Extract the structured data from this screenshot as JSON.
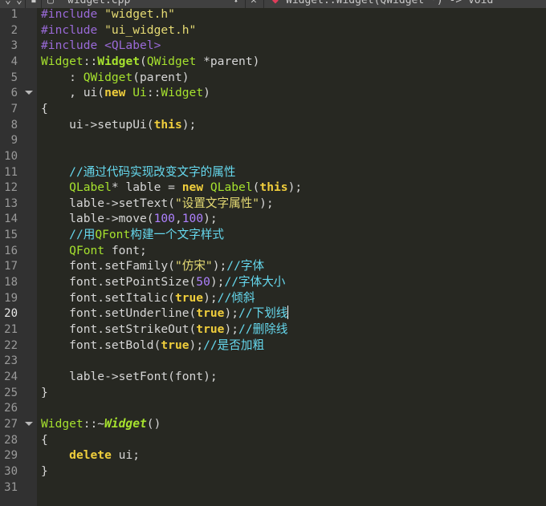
{
  "tabbar": {
    "file_name": "widget.cpp",
    "close_glyph": "✕",
    "symbol_glyph": "◆",
    "function_symbol": "Widget::Widget(QWidget *) -> void"
  },
  "colors": {
    "background": "#272822",
    "gutter": "#313131",
    "line_number": "#9a9a9a",
    "preprocessor": "#9a6ad8",
    "string": "#e6db74",
    "type": "#a6e22e",
    "keyword": "#f0ce3c",
    "number": "#ae81ff",
    "comment_text": "#66d9ef",
    "plain": "#d6d6d6"
  },
  "editor": {
    "current_line": 20,
    "fold_markers": [
      6,
      27
    ],
    "lines": [
      [
        [
          "#include ",
          "pp"
        ],
        [
          "\"widget.h\"",
          "str"
        ]
      ],
      [
        [
          "#include ",
          "pp"
        ],
        [
          "\"ui_widget.h\"",
          "str"
        ]
      ],
      [
        [
          "#include ",
          "pp"
        ],
        [
          "<QLabel>",
          "pp"
        ]
      ],
      [
        [
          "Widget",
          "type"
        ],
        [
          "::",
          ""
        ],
        [
          "Widget",
          "typeb"
        ],
        [
          "(",
          ""
        ],
        [
          "QWidget",
          "type"
        ],
        [
          " *parent)",
          ""
        ]
      ],
      [
        [
          "    : ",
          ""
        ],
        [
          "QWidget",
          "type"
        ],
        [
          "(parent)",
          ""
        ]
      ],
      [
        [
          "    , ui(",
          ""
        ],
        [
          "new",
          "kw"
        ],
        [
          " ",
          ""
        ],
        [
          "Ui",
          "type"
        ],
        [
          "::",
          ""
        ],
        [
          "Widget",
          "type"
        ],
        [
          ")",
          ""
        ]
      ],
      [
        [
          "{",
          ""
        ]
      ],
      [
        [
          "    ui->setupUi(",
          ""
        ],
        [
          "this",
          "kw"
        ],
        [
          ");",
          ""
        ]
      ],
      [],
      [],
      [
        [
          "    ",
          ""
        ],
        [
          "//通过代码实现改变文字的属性",
          "cm"
        ]
      ],
      [
        [
          "    ",
          ""
        ],
        [
          "QLabel",
          "type"
        ],
        [
          "* lable = ",
          ""
        ],
        [
          "new",
          "kw"
        ],
        [
          " ",
          ""
        ],
        [
          "QLabel",
          "type"
        ],
        [
          "(",
          ""
        ],
        [
          "this",
          "kw"
        ],
        [
          ");",
          ""
        ]
      ],
      [
        [
          "    lable->setText(",
          ""
        ],
        [
          "\"设置文字属性\"",
          "str"
        ],
        [
          ");",
          ""
        ]
      ],
      [
        [
          "    lable->move(",
          ""
        ],
        [
          "100",
          "num"
        ],
        [
          ",",
          ""
        ],
        [
          "100",
          "num"
        ],
        [
          ");",
          ""
        ]
      ],
      [
        [
          "    ",
          ""
        ],
        [
          "//用",
          "cm"
        ],
        [
          "QFont",
          "type"
        ],
        [
          "构建一个文字样式",
          "cm"
        ]
      ],
      [
        [
          "    ",
          ""
        ],
        [
          "QFont",
          "type"
        ],
        [
          " font;",
          ""
        ]
      ],
      [
        [
          "    font.setFamily(",
          ""
        ],
        [
          "\"仿宋\"",
          "str"
        ],
        [
          ");",
          ""
        ],
        [
          "//字体",
          "cm"
        ]
      ],
      [
        [
          "    font.setPointSize(",
          ""
        ],
        [
          "50",
          "num"
        ],
        [
          ");",
          ""
        ],
        [
          "//字体大小",
          "cm"
        ]
      ],
      [
        [
          "    font.setItalic(",
          ""
        ],
        [
          "true",
          "kw"
        ],
        [
          ");",
          ""
        ],
        [
          "//倾斜",
          "cm"
        ]
      ],
      [
        [
          "    font.setUnderline(",
          ""
        ],
        [
          "true",
          "kw"
        ],
        [
          ");",
          ""
        ],
        [
          "//下划线",
          "cm"
        ],
        [
          "",
          "caret"
        ]
      ],
      [
        [
          "    font.setStrikeOut(",
          ""
        ],
        [
          "true",
          "kw"
        ],
        [
          ");",
          ""
        ],
        [
          "//删除线",
          "cm"
        ]
      ],
      [
        [
          "    font.setBold(",
          ""
        ],
        [
          "true",
          "kw"
        ],
        [
          ");",
          ""
        ],
        [
          "//是否加粗",
          "cm"
        ]
      ],
      [],
      [
        [
          "    lable->setFont(font);",
          ""
        ]
      ],
      [
        [
          "}",
          ""
        ]
      ],
      [],
      [
        [
          "Widget",
          "type"
        ],
        [
          "::~",
          ""
        ],
        [
          "Widget",
          "typebi"
        ],
        [
          "()",
          ""
        ]
      ],
      [
        [
          "{",
          ""
        ]
      ],
      [
        [
          "    ",
          ""
        ],
        [
          "delete",
          "kw"
        ],
        [
          " ui;",
          ""
        ]
      ],
      [
        [
          "}",
          ""
        ]
      ],
      []
    ]
  }
}
